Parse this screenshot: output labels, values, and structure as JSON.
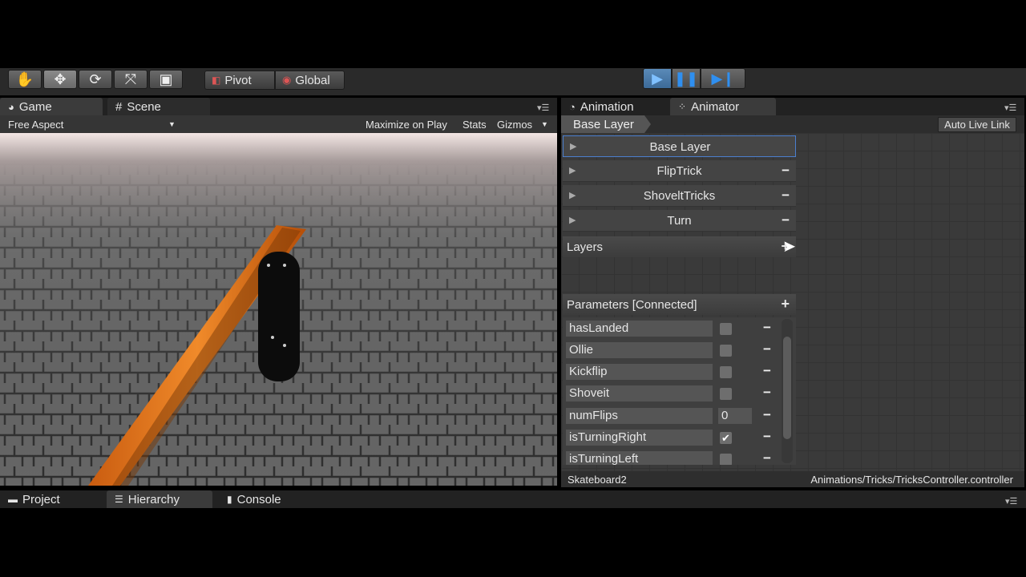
{
  "toolbar": {
    "tools": [
      {
        "icon": "hand-icon",
        "glyph": "✋"
      },
      {
        "icon": "move-icon",
        "glyph": "✥"
      },
      {
        "icon": "rotate-icon",
        "glyph": "⟳"
      },
      {
        "icon": "scale-icon",
        "glyph": "⤧"
      },
      {
        "icon": "rect-icon",
        "glyph": "▣"
      }
    ],
    "pivot_label": "Pivot",
    "global_label": "Global"
  },
  "left_tabs": {
    "game": "Game",
    "scene": "Scene"
  },
  "game_bar": {
    "aspect": "Free Aspect",
    "maximize": "Maximize on Play",
    "stats": "Stats",
    "gizmos": "Gizmos"
  },
  "right_tabs": {
    "animation": "Animation",
    "animator": "Animator"
  },
  "animator": {
    "breadcrumb": "Base Layer",
    "auto_live_link": "Auto Live Link",
    "layers": [
      "Base Layer",
      "FlipTrick",
      "ShoveltTricks",
      "Turn"
    ],
    "layers_header": "Layers",
    "params_header": "Parameters [Connected]",
    "parameters": [
      {
        "name": "hasLanded",
        "type": "bool",
        "checked": false
      },
      {
        "name": "Ollie",
        "type": "bool",
        "checked": false
      },
      {
        "name": "Kickflip",
        "type": "bool",
        "checked": false
      },
      {
        "name": "Shoveit",
        "type": "bool",
        "checked": false
      },
      {
        "name": "numFlips",
        "type": "int",
        "value": "0"
      },
      {
        "name": "isTurningRight",
        "type": "bool",
        "checked": true
      },
      {
        "name": "isTurningLeft",
        "type": "bool",
        "checked": false
      }
    ],
    "status_object": "Skateboard2",
    "status_path": "Animations/Tricks/TricksController.controller"
  },
  "bottom_tabs": {
    "project": "Project",
    "hierarchy": "Hierarchy",
    "console": "Console"
  },
  "colors": {
    "accent_blue": "#2f8ff0",
    "rail_orange": "#e8761a"
  }
}
